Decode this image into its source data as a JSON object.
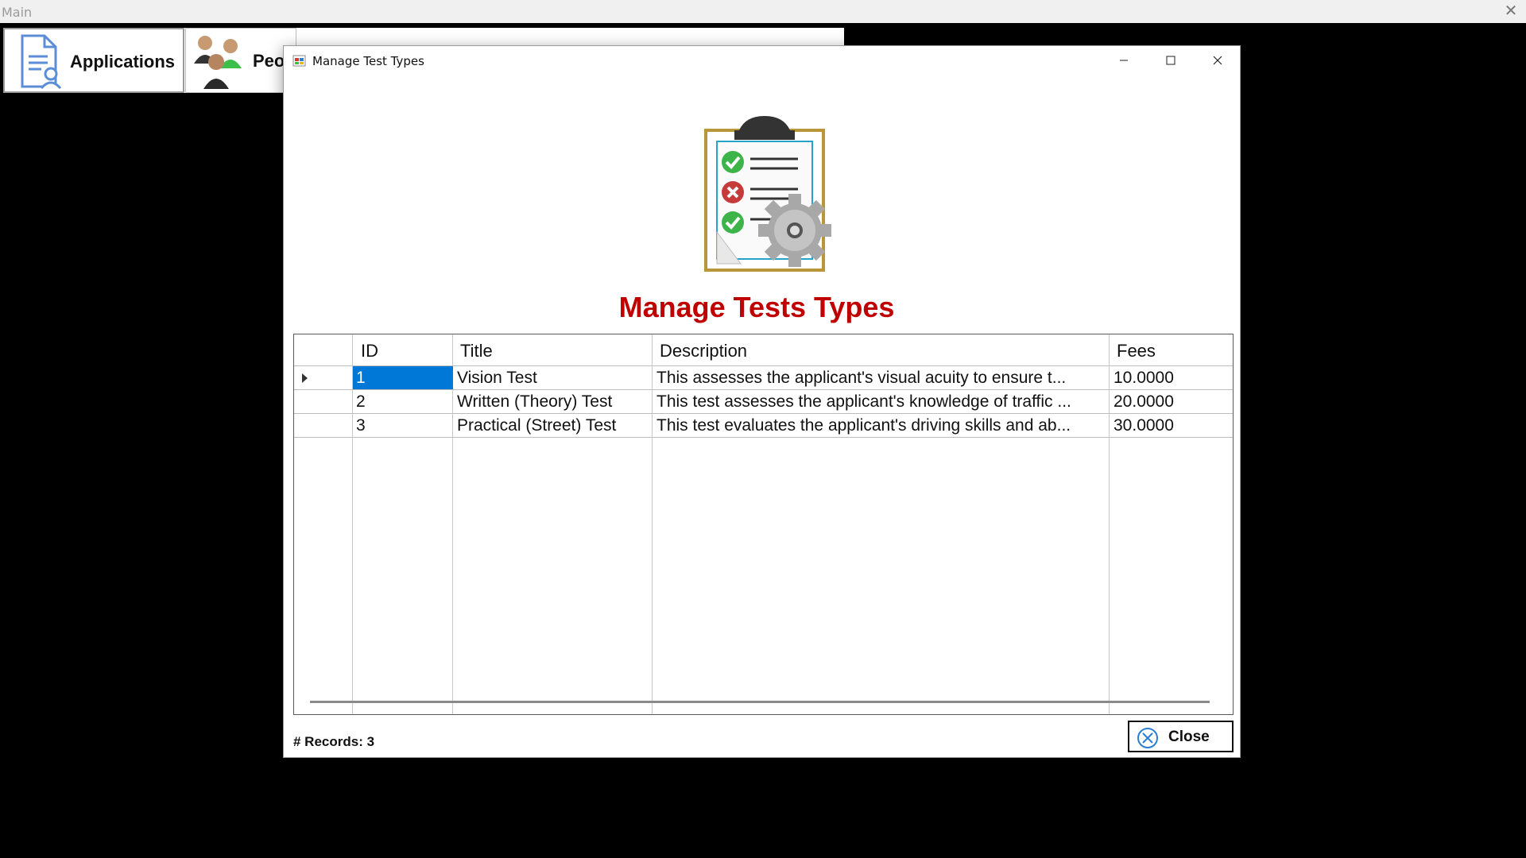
{
  "main_window": {
    "title": "Main"
  },
  "toolbar": {
    "applications_label": "Applications",
    "people_label": "Peo"
  },
  "dialog": {
    "title": "Manage Test Types",
    "heading": "Manage Tests Types",
    "records_label": "# Records: 3",
    "close_label": "Close"
  },
  "grid": {
    "columns": [
      "ID",
      "Title",
      "Description",
      "Fees"
    ],
    "rows": [
      {
        "id": "1",
        "title": "Vision Test",
        "description": "This assesses the applicant's visual acuity to ensure t...",
        "fees": "10.0000"
      },
      {
        "id": "2",
        "title": "Written (Theory) Test",
        "description": "This test assesses the applicant's knowledge of traffic ...",
        "fees": "20.0000"
      },
      {
        "id": "3",
        "title": "Practical (Street) Test",
        "description": "This test evaluates the applicant's driving skills and ab...",
        "fees": "30.0000"
      }
    ],
    "selected_row": 0
  },
  "colors": {
    "heading": "#c00000",
    "selection": "#0078d7",
    "close_icon": "#2a7fd4"
  },
  "icons": {
    "hero": "clipboard-gear-icon",
    "applications": "document-user-icon",
    "people": "people-group-icon",
    "close_button": "circle-x-icon"
  }
}
